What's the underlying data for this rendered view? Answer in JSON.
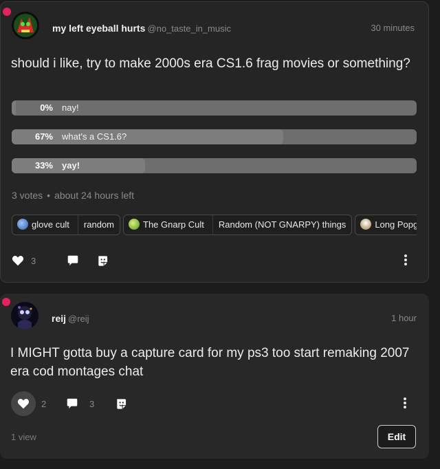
{
  "posts": [
    {
      "author": {
        "display_name": "my left eyeball hurts",
        "handle": "@no_taste_in_music"
      },
      "time": "30 minutes",
      "text": "should i like, try to make 2000s era CS1.6 frag movies or something?",
      "poll": {
        "options": [
          {
            "percent_label": "0%",
            "label": "nay!",
            "fraction": 0.0
          },
          {
            "percent_label": "67%",
            "label": "what's a CS1.6?",
            "fraction": 0.67
          },
          {
            "percent_label": "33%",
            "label": "yay!",
            "fraction": 0.33
          }
        ],
        "votes": "3 votes",
        "separator": "•",
        "time_left": "about 24 hours left"
      },
      "tags": [
        {
          "community": "glove cult",
          "channel": "random",
          "icon_color": "#5a8fd0"
        },
        {
          "community": "The Gnarp Cult",
          "channel": "Random (NOT GNARPY) things",
          "icon_color": "#7cc43a"
        },
        {
          "community": "Long Popg",
          "channel": "",
          "icon_color": "#e0e0e0"
        }
      ],
      "like_count": "3"
    },
    {
      "author": {
        "display_name": "reij",
        "handle": "@reij"
      },
      "time": "1 hour",
      "text": "I MIGHT gotta buy a capture card for my ps3 too start remaking 2007 era cod montages chat",
      "like_count": "2",
      "comment_count": "3",
      "views": "1 view",
      "edit_label": "Edit"
    }
  ],
  "colors": {
    "unread_dot": "#e8205e",
    "background": "#1c1c1c",
    "card": "#252525"
  }
}
